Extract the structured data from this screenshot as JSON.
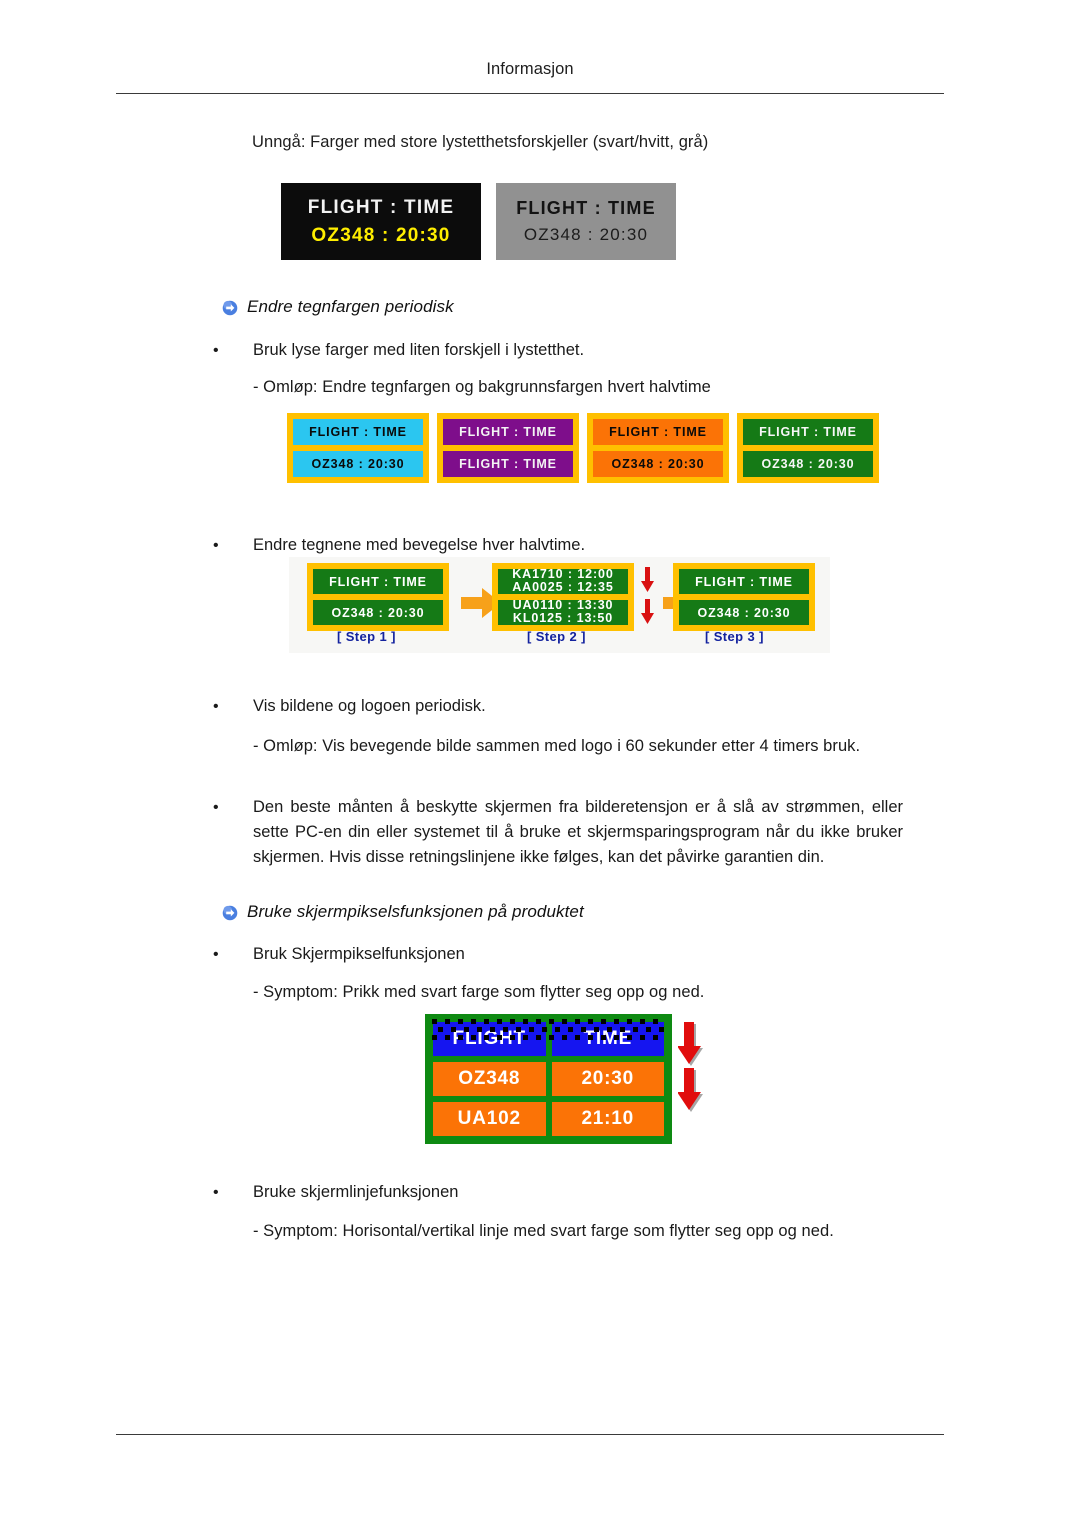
{
  "page": {
    "header_title": "Informasjon"
  },
  "intro": {
    "text": "Unngå: Farger med store lystetthetsforskjeller (svart/hvitt, grå)"
  },
  "boards": {
    "dark": {
      "line1": "FLIGHT : TIME",
      "line2": "OZ348  :  20:30"
    },
    "gray": {
      "line1": "FLIGHT : TIME",
      "line2": "OZ348  :  20:30"
    }
  },
  "section1": {
    "title": "Endre tegnfargen periodisk",
    "bullet1": "Bruk lyse farger med liten forskjell i lystetthet.",
    "sub1": "- Omløp: Endre tegnfargen og bakgrunnsfargen hvert halvtime",
    "bullet2": "Endre tegnene med bevegelse hver halvtime.",
    "bullet3": "Vis bildene og logoen periodisk.",
    "sub3": "- Omløp: Vis bevegende bilde sammen med logo i 60 sekunder etter 4 timers bruk.",
    "bullet4": "Den beste månten å beskytte skjermen fra bilderetensjon er å slå av strømmen, eller sette PC-en din eller systemet til å bruke et skjermsparingsprogram når du ikke bruker skjermen. Hvis disse retningslinjene ikke følges, kan det påvirke garantien din."
  },
  "swatches": [
    {
      "name": "cyan",
      "line1": "FLIGHT : TIME",
      "line2": "OZ348  :  20:30",
      "bg": "#2BC6F0",
      "fg": "#0a0a0a",
      "border": "#FFC000"
    },
    {
      "name": "purple",
      "line1": "FLIGHT : TIME",
      "line2": "FLIGHT : TIME",
      "bg": "#7E0E8B",
      "fg": "#f3f3f3",
      "border": "#FFC000"
    },
    {
      "name": "orange",
      "line1": "FLIGHT : TIME",
      "line2": "OZ348  :  20:30",
      "bg": "#FB7306",
      "fg": "#0a0a0a",
      "border": "#FFC000"
    },
    {
      "name": "green",
      "line1": "FLIGHT : TIME",
      "line2": "OZ348  :  20:30",
      "bg": "#157A16",
      "fg": "#f7f7f7",
      "border": "#FFC000"
    }
  ],
  "steps": {
    "step1": {
      "label": "[ Step 1 ]",
      "line1": "FLIGHT : TIME",
      "line2": "OZ348  :  20:30"
    },
    "step2": {
      "label": "[ Step 2 ]",
      "cell1_top": "KA1710 :  12:00",
      "cell1_bottom": "AA0025 :  12:35",
      "cell2_top": "UA0110 :  13:30",
      "cell2_bottom": "KL0125 :  13:50"
    },
    "step3": {
      "label": "[ Step 3 ]",
      "line1": "FLIGHT : TIME",
      "line2": "OZ348  :  20:30"
    }
  },
  "section2": {
    "title": "Bruke skjermpikselsfunksjonen på produktet",
    "bullet1": "Bruk Skjermpikselfunksjonen",
    "sub1": "- Symptom: Prikk med svart farge som flytter seg opp og ned.",
    "bullet2": "Bruke skjermlinjefunksjonen",
    "sub2": "- Symptom: Horisontal/vertikal linje med svart farge som flytter seg opp og ned."
  },
  "big_board": {
    "header_flight": "FLIGHT",
    "header_time": "TIME",
    "row1_flight": "OZ348",
    "row1_time": "20:30",
    "row2_flight": "UA102",
    "row2_time": "21:10",
    "frame_color": "#0E8A12",
    "header_color": "#1515F0",
    "row_color": "#FB7306"
  },
  "bullet_char": "•"
}
